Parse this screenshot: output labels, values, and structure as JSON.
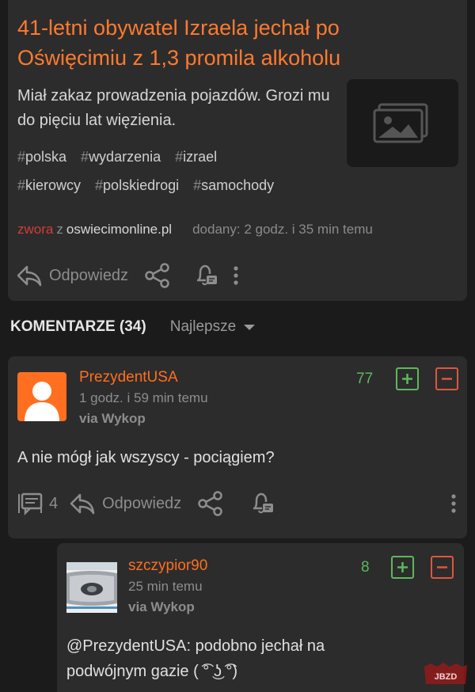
{
  "article": {
    "title": "41-letni obywatel Izraela jechał po Oświęcimiu z 1,3 promila alkoholu",
    "description": "Miał zakaz prowadzenia pojazdów. Grozi mu do pięciu lat więzienia.",
    "tags_row1": [
      "polska",
      "wydarzenia",
      "izrael"
    ],
    "tags_row2": [
      "kierowcy",
      "polskiedrogi",
      "samochody"
    ],
    "author": "zwora",
    "from": "z",
    "site": "oswiecimonline.pl",
    "added": "dodany: 2 godz. i 35 min temu",
    "reply_label": "Odpowiedz"
  },
  "comments_header": {
    "title": "KOMENTARZE (34)",
    "sort": "Najlepsze"
  },
  "comment1": {
    "user": "PrezydentUSA",
    "time": "1 godz. i 59 min temu",
    "via": "via Wykop",
    "score": "77",
    "text": "A nie mógł jak wszyscy - pociągiem?",
    "replies_count": "4",
    "reply_label": "Odpowiedz"
  },
  "comment2": {
    "user": "szczypior90",
    "time": "25 min temu",
    "via": "via Wykop",
    "score": "8",
    "text": "@PrezydentUSA: podobno jechał na podwójnym gazie ( ͡° ͜ʖ ͡°)"
  },
  "watermark": "JBZD",
  "colors": {
    "accent": "#ff6f1f",
    "title": "#ff7a2f",
    "upvote": "#5cb85c",
    "downvote": "#e0553e",
    "author": "#d63a3a"
  }
}
